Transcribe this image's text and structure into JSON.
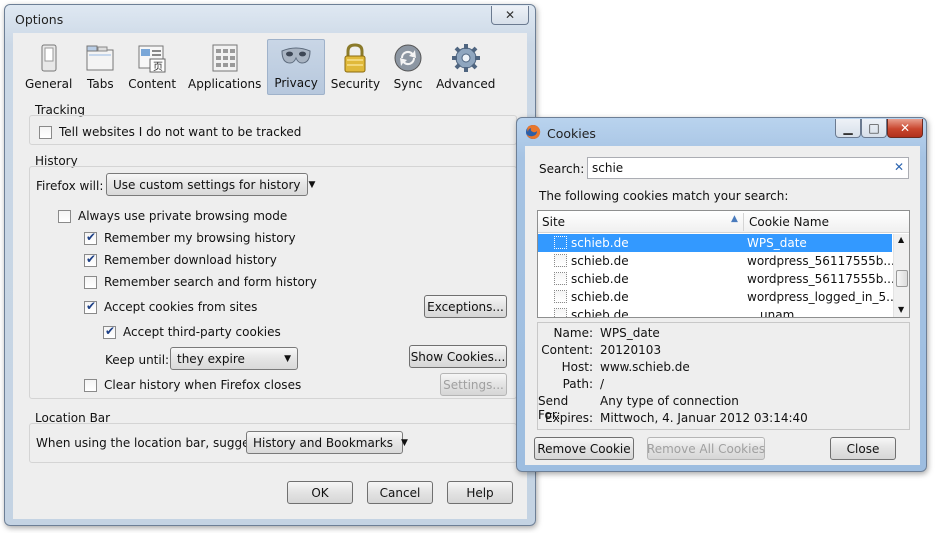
{
  "options": {
    "title": "Options",
    "tabs": [
      {
        "label": "General",
        "icon": "general-switch-icon"
      },
      {
        "label": "Tabs",
        "icon": "tabs-icon"
      },
      {
        "label": "Content",
        "icon": "content-icon"
      },
      {
        "label": "Applications",
        "icon": "applications-icon"
      },
      {
        "label": "Privacy",
        "icon": "privacy-mask-icon",
        "selected": true
      },
      {
        "label": "Security",
        "icon": "security-lock-icon"
      },
      {
        "label": "Sync",
        "icon": "sync-icon"
      },
      {
        "label": "Advanced",
        "icon": "advanced-gear-icon"
      }
    ],
    "tracking": {
      "legend": "Tracking",
      "dnt_label": "Tell websites I do not want to be tracked",
      "dnt_checked": false
    },
    "history": {
      "legend": "History",
      "will_label": "Firefox will:",
      "will_value": "Use custom settings for history",
      "private_label": "Always use private browsing mode",
      "browsing_label": "Remember my browsing history",
      "download_label": "Remember download history",
      "search_label": "Remember search and form history",
      "cookies_label": "Accept cookies from sites",
      "exceptions_button": "Exceptions...",
      "third_party_label": "Accept third-party cookies",
      "keep_until_label": "Keep until:",
      "keep_until_value": "they expire",
      "show_cookies_button": "Show Cookies...",
      "clear_label": "Clear history when Firefox closes",
      "settings_button": "Settings..."
    },
    "location_bar": {
      "legend": "Location Bar",
      "suggest_label": "When using the location bar, suggest:",
      "suggest_value": "History and Bookmarks"
    },
    "buttons": {
      "ok": "OK",
      "cancel": "Cancel",
      "help": "Help"
    }
  },
  "cookies": {
    "title": "Cookies",
    "search_label": "Search:",
    "search_value": "schie",
    "match_text": "The following cookies match your search:",
    "columns": {
      "site": "Site",
      "name": "Cookie Name"
    },
    "rows": [
      {
        "site": "schieb.de",
        "name": "WPS_date",
        "selected": true
      },
      {
        "site": "schieb.de",
        "name": "wordpress_56117555b..."
      },
      {
        "site": "schieb.de",
        "name": "wordpress_56117555b..."
      },
      {
        "site": "schieb.de",
        "name": "wordpress_logged_in_5..."
      },
      {
        "site": "schieb.de",
        "name": "unam"
      }
    ],
    "details": {
      "name_label": "Name:",
      "name_value": "WPS_date",
      "content_label": "Content:",
      "content_value": "20120103",
      "host_label": "Host:",
      "host_value": "www.schieb.de",
      "path_label": "Path:",
      "path_value": "/",
      "sendfor_label": "Send For:",
      "sendfor_value": "Any type of connection",
      "expires_label": "Expires:",
      "expires_value": "Mittwoch, 4. Januar 2012 03:14:40"
    },
    "buttons": {
      "remove": "Remove Cookie",
      "remove_all": "Remove All Cookies",
      "close": "Close"
    }
  }
}
